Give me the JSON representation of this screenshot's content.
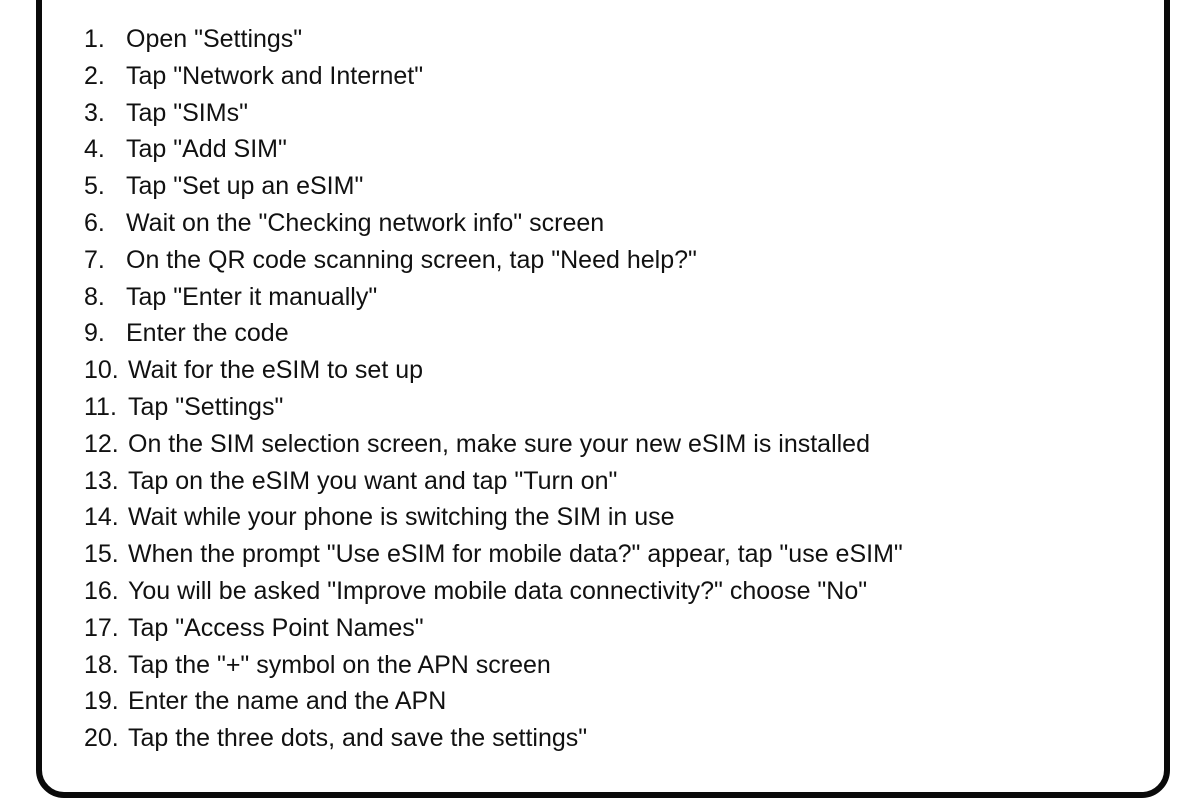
{
  "document": {
    "steps": [
      {
        "number": "1.",
        "text": "Open \"Settings\""
      },
      {
        "number": "2.",
        "text": "Tap \"Network and Internet\""
      },
      {
        "number": "3.",
        "text": "Tap \"SIMs\""
      },
      {
        "number": "4.",
        "text": "Tap \"Add SIM\""
      },
      {
        "number": "5.",
        "text": "Tap \"Set up an eSIM\""
      },
      {
        "number": "6.",
        "text": "Wait on the \"Checking network info\" screen"
      },
      {
        "number": "7.",
        "text": "On the QR code scanning screen, tap \"Need help?\""
      },
      {
        "number": "8.",
        "text": "Tap \"Enter it manually\""
      },
      {
        "number": "9.",
        "text": "Enter the code"
      },
      {
        "number": "10.",
        "text": "Wait for the eSIM to set up"
      },
      {
        "number": "11.",
        "text": "Tap \"Settings\""
      },
      {
        "number": "12.",
        "text": "On the SIM selection screen, make sure your new eSIM is installed"
      },
      {
        "number": "13.",
        "text": "Tap on the eSIM you want and tap \"Turn on\""
      },
      {
        "number": "14.",
        "text": "Wait while your phone is switching the SIM in use"
      },
      {
        "number": "15.",
        "text": "When the prompt \"Use eSIM for mobile data?\" appear, tap \"use eSIM\""
      },
      {
        "number": "16.",
        "text": "You will be asked \"Improve mobile data connectivity?\" choose \"No\""
      },
      {
        "number": "17.",
        "text": "Tap \"Access Point Names\""
      },
      {
        "number": "18.",
        "text": "Tap the \"+\" symbol on the APN screen"
      },
      {
        "number": "19.",
        "text": "Enter the name and the APN"
      },
      {
        "number": "20.",
        "text": "Tap the three dots, and save the settings\""
      }
    ]
  },
  "colors": {
    "border": "#0a0a0a",
    "text": "#111111",
    "background": "#ffffff"
  }
}
